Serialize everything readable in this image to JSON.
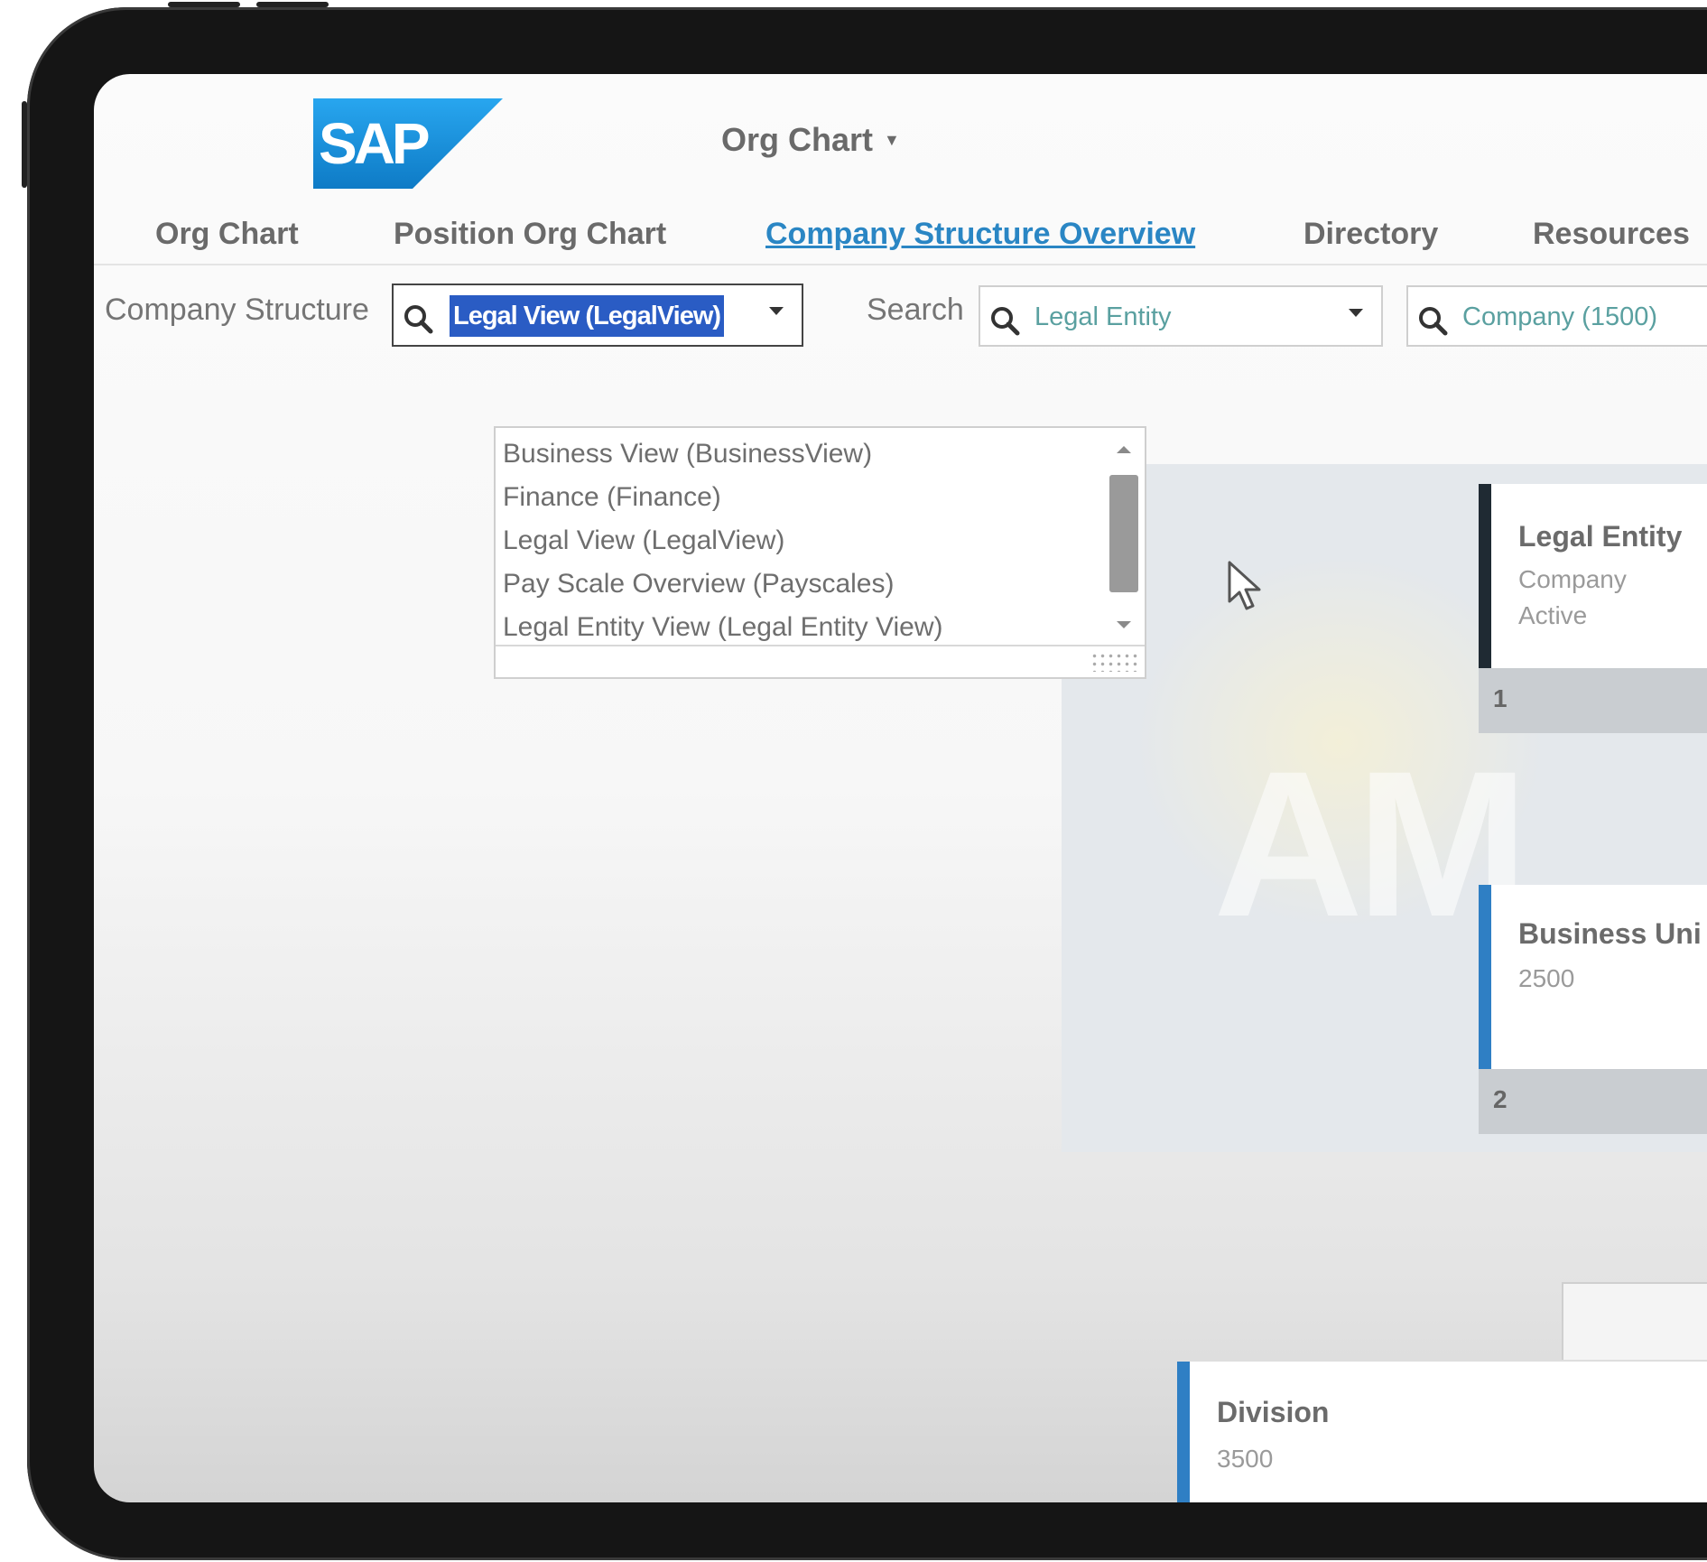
{
  "app": {
    "logo_text": "SAP",
    "title": "Org Chart"
  },
  "nav": {
    "tabs": [
      {
        "label": "Org Chart"
      },
      {
        "label": "Position Org Chart"
      },
      {
        "label": "Company Structure Overview",
        "active": true
      },
      {
        "label": "Directory"
      },
      {
        "label": "Resources"
      }
    ]
  },
  "filters": {
    "company_structure_label": "Company Structure",
    "company_structure_value": "Legal View (LegalView)",
    "search_label": "Search",
    "search_value": "Legal Entity",
    "company_value": "Company (1500)"
  },
  "dropdown": {
    "options": [
      "Business View (BusinessView)",
      "Finance (Finance)",
      "Legal View (LegalView)",
      "Pay Scale Overview (Payscales)",
      "Legal Entity View (Legal Entity View)"
    ]
  },
  "cards": {
    "legal_entity": {
      "title": "Legal Entity",
      "line1": "Company",
      "line2": "Active",
      "count": "1"
    },
    "business_unit": {
      "title": "Business Uni",
      "line1": "2500",
      "count": "2"
    },
    "division": {
      "title": "Division",
      "line1": "3500"
    }
  },
  "colors": {
    "sap_blue": "#1a8ed8",
    "active_link": "#2a86c4",
    "legal_entity_bar": "#1f2a33",
    "unit_bar": "#2f7fc4",
    "selection": "#2a5cc4"
  },
  "icons": [
    "search-icon",
    "dropdown-caret-icon",
    "mouse-cursor-icon",
    "resize-grip-icon"
  ]
}
